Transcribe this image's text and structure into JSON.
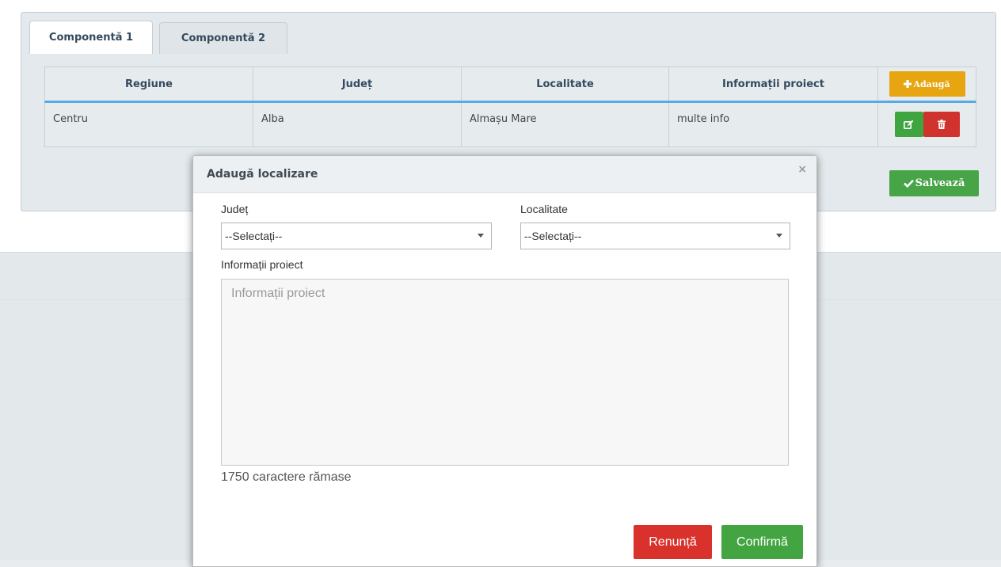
{
  "tabs": [
    {
      "label": "Componentă 1"
    },
    {
      "label": "Componentă 2"
    }
  ],
  "table": {
    "headers": [
      "Regiune",
      "Județ",
      "Localitate",
      "Informații proiect"
    ],
    "add_label": "Adaugă",
    "rows": [
      {
        "regiune": "Centru",
        "judet": "Alba",
        "localitate": "Almașu Mare",
        "info": "multe info"
      }
    ]
  },
  "save_label": "Salvează",
  "modal": {
    "title": "Adaugă localizare",
    "close": "×",
    "judet_label": "Județ",
    "judet_value": "--Selectați--",
    "localitate_label": "Localitate",
    "localitate_value": "--Selectați--",
    "info_label": "Informații proiect",
    "info_placeholder": "Informații proiect",
    "counter": "1750 caractere rămase",
    "cancel_label": "Renunță",
    "confirm_label": "Confirmă"
  },
  "colors": {
    "accent_blue": "#5aa8e6",
    "add_button": "#e6a511",
    "success": "#47a447",
    "danger": "#d0322d",
    "logo": "#e8233a"
  },
  "icons": {
    "add": "plus-icon",
    "edit": "edit-icon",
    "delete": "trash-icon",
    "save": "check-icon",
    "close": "close-icon"
  }
}
